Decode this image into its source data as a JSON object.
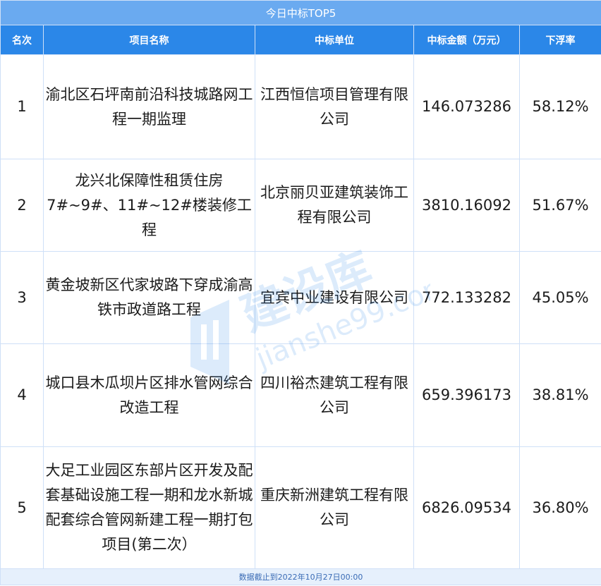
{
  "table": {
    "title": "今日中标TOP5",
    "headers": [
      "名次",
      "项目名称",
      "中标单位",
      "中标金额（万元）",
      "下浮率"
    ],
    "rows": [
      {
        "rank": "1",
        "project": "渝北区石坪南前沿科技城路网工程一期监理",
        "winner": "江西恒信项目管理有限公司",
        "amount": "146.073286",
        "rate": "58.12%"
      },
      {
        "rank": "2",
        "project": "龙兴北保障性租赁住房7#~9#、11#~12#楼装修工程",
        "winner": "北京丽贝亚建筑装饰工程有限公司",
        "amount": "3810.16092",
        "rate": "51.67%"
      },
      {
        "rank": "3",
        "project": "黄金坡新区代家坡路下穿成渝高铁市政道路工程",
        "winner": "宜宾中业建设有限公司",
        "amount": "772.133282",
        "rate": "45.05%"
      },
      {
        "rank": "4",
        "project": "城口县木瓜坝片区排水管网综合改造工程",
        "winner": "四川裕杰建筑工程有限公司",
        "amount": "659.396173",
        "rate": "38.81%"
      },
      {
        "rank": "5",
        "project": "大足工业园区东部片区开发及配套基础设施工程一期和龙水新城配套综合管网新建工程一期打包项目(第二次）",
        "winner": "重庆新洲建筑工程有限公司",
        "amount": "6826.09534",
        "rate": "36.80%"
      }
    ],
    "footer": "数据截止到2022年10月27日00:00"
  },
  "watermark": {
    "brand": "建设库",
    "domain": "jianshe99.com",
    "color": "#2b87e8"
  }
}
